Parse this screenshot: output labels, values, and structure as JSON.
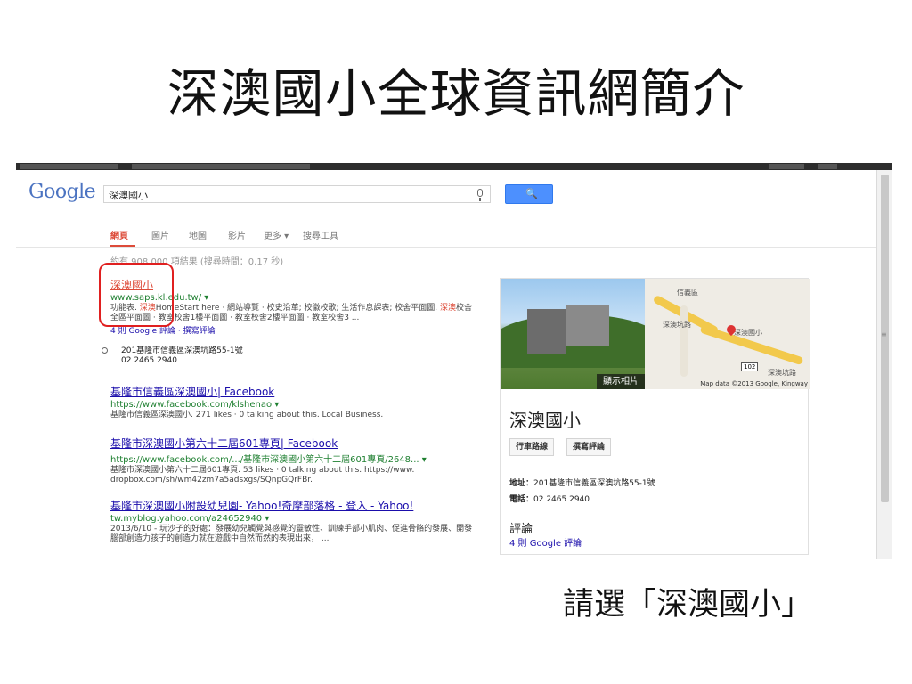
{
  "slide": {
    "title": "深澳國小全球資訊網簡介",
    "caption": "請選「深澳國小」"
  },
  "google": {
    "logo": "Google",
    "search_query": "深澳國小",
    "search_button": "🔍",
    "tabs": [
      "網頁",
      "圖片",
      "地圖",
      "影片",
      "更多 ▾",
      "搜尋工具"
    ],
    "stats": "約有 908,000 項結果 (搜尋時間：0.17 秒)"
  },
  "results": [
    {
      "title": "深澳國小",
      "url": "www.saps.kl.edu.tw/ ▾",
      "snippet_a": "功能表. ",
      "snippet_hl": "深澳",
      "snippet_b": "HomeStart here · 網站導覽 · 校史沿革; 校徽校歌; 生活作息課表; 校舍平面圖. ",
      "snippet_hl2": "深澳",
      "snippet_c": "校舍全區平面圖 · 教室校舍1樓平面圖 · 教室校舍2樓平面圖 · 教室校舍3 ...",
      "reviews": "4 則 Google 評論 · 撰寫評論"
    },
    {
      "title": "基隆市信義區深澳國小| Facebook",
      "url": "https://www.facebook.com/klshenao ▾",
      "snippet": "基隆市信義區深澳國小. 271 likes · 0 talking about this. Local Business."
    },
    {
      "title": "基隆市深澳國小第六十二屆601專頁| Facebook",
      "url": "https://www.facebook.com/.../基隆市深澳國小第六十二屆601專頁/2648... ▾",
      "snippet": "基隆市深澳國小第六十二屆601專頁. 53 likes · 0 talking about this. https://www. dropbox.com/sh/wm42zm7a5adsxgs/SQnpGQrFBr."
    },
    {
      "title": "基隆市深澳國小附設幼兒園- Yahoo!奇摩部落格 - 登入 - Yahoo!",
      "url": "tw.myblog.yahoo.com/a24652940 ▾",
      "snippet": "2013/6/10 - 玩沙子的好處：發展幼兒觸覺與感覺的靈敏性、訓練手部小肌肉、促進骨骼的發展、開發腦部創造力孩子的創造力就在遊戲中自然而然的表現出來， ..."
    }
  ],
  "location": {
    "address": "201基隆市信義區深澳坑路55-1號",
    "phone": "02 2465 2940"
  },
  "panel": {
    "photo_button": "顯示相片",
    "map_labels": [
      "信義區",
      "深澳坑路",
      "深澳國小",
      "深澳坑路"
    ],
    "map_shield": "102",
    "map_credit": "Map data ©2013 Google, Kingway",
    "name": "深澳國小",
    "btn_directions": "行車路線",
    "btn_review": "撰寫評論",
    "address_label": "地址：",
    "address": "201基隆市信義區深澳坑路55-1號",
    "phone_label": "電話：",
    "phone": "02 2465 2940",
    "reviews_heading": "評論",
    "reviews_link": "4 則 Google 評論"
  },
  "colors": {
    "highlight_box": "#e02020",
    "link": "#1a0dab",
    "url_green": "#1e7f30",
    "search_blue": "#4d90fe"
  }
}
